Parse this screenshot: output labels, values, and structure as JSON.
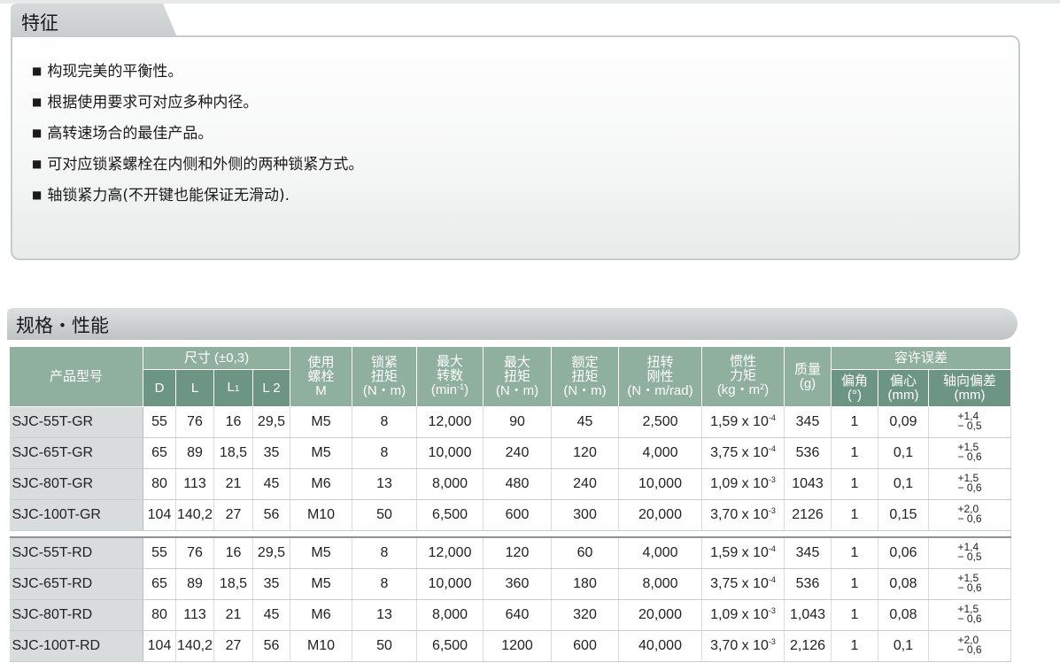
{
  "features": {
    "title": "特征",
    "items": [
      "构现完美的平衡性。",
      "根据使用要求可对应多种内径。",
      "高转速场合的最佳产品。",
      "可对应锁紧螺栓在内侧和外侧的两种锁紧方式。",
      "轴锁紧力高(不开键也能保证无滑动)."
    ]
  },
  "specs": {
    "title": "规格・性能",
    "headers": {
      "model": "产品型号",
      "dims": "尺寸 (±0,3)",
      "d": "D",
      "l": "L",
      "l1_base": "L",
      "l1_sub": "1",
      "l2": "L 2",
      "bolt_1": "使用",
      "bolt_2": "螺栓",
      "bolt_3": "M",
      "lock_1": "锁紧",
      "lock_2": "扭矩",
      "lock_3": "(N・m)",
      "speed_1": "最大",
      "speed_2": "转数",
      "speed_3": "(min",
      "speed_sup": "-1",
      "speed_4": ")",
      "maxt_1": "最大",
      "maxt_2": "扭矩",
      "maxt_3": "(N・m)",
      "rated_1": "额定",
      "rated_2": "扭矩",
      "rated_3": "(N・m)",
      "stiff_1": "扭转",
      "stiff_2": "刚性",
      "stiff_3": "(N・m/rad)",
      "inertia_1": "惯性",
      "inertia_2": "力矩",
      "inertia_3": "(kg・m",
      "inertia_sup": "2",
      "inertia_4": ")",
      "mass_1": "质量",
      "mass_2": "(g)",
      "tol": "容许误差",
      "ang_1": "偏角",
      "ang_2": "(°)",
      "ecc_1": "偏心",
      "ecc_2": "(mm)",
      "axial_1": "轴向偏差",
      "axial_2": "(mm)"
    },
    "group1": [
      {
        "model": "SJC-55T-GR",
        "d": "55",
        "l": "76",
        "l1": "16",
        "l2": "29,5",
        "bolt": "M5",
        "lock": "8",
        "speed": "12,000",
        "maxt": "90",
        "rated": "45",
        "stiff": "2,500",
        "inertia": "1,59 x 10",
        "inertia_exp": "-4",
        "mass": "345",
        "ang": "1",
        "ecc": "0,09",
        "tol_plus": "+1,4",
        "tol_minus": "− 0,5"
      },
      {
        "model": "SJC-65T-GR",
        "d": "65",
        "l": "89",
        "l1": "18,5",
        "l2": "35",
        "bolt": "M5",
        "lock": "8",
        "speed": "10,000",
        "maxt": "240",
        "rated": "120",
        "stiff": "4,000",
        "inertia": "3,75 x 10",
        "inertia_exp": "-4",
        "mass": "536",
        "ang": "1",
        "ecc": "0,1",
        "tol_plus": "+1,5",
        "tol_minus": "− 0,6"
      },
      {
        "model": "SJC-80T-GR",
        "d": "80",
        "l": "113",
        "l1": "21",
        "l2": "45",
        "bolt": "M6",
        "lock": "13",
        "speed": "8,000",
        "maxt": "480",
        "rated": "240",
        "stiff": "10,000",
        "inertia": "1,09 x 10",
        "inertia_exp": "-3",
        "mass": "1043",
        "ang": "1",
        "ecc": "0,1",
        "tol_plus": "+1,5",
        "tol_minus": "− 0,6"
      },
      {
        "model": "SJC-100T-GR",
        "d": "104",
        "l": "140,2",
        "l1": "27",
        "l2": "56",
        "bolt": "M10",
        "lock": "50",
        "speed": "6,500",
        "maxt": "600",
        "rated": "300",
        "stiff": "20,000",
        "inertia": "3,70 x 10",
        "inertia_exp": "-3",
        "mass": "2126",
        "ang": "1",
        "ecc": "0,15",
        "tol_plus": "+2,0",
        "tol_minus": "− 0,6"
      }
    ],
    "group2": [
      {
        "model": "SJC-55T-RD",
        "d": "55",
        "l": "76",
        "l1": "16",
        "l2": "29,5",
        "bolt": "M5",
        "lock": "8",
        "speed": "12,000",
        "maxt": "120",
        "rated": "60",
        "stiff": "4,000",
        "inertia": "1,59 x 10",
        "inertia_exp": "-4",
        "mass": "345",
        "ang": "1",
        "ecc": "0,06",
        "tol_plus": "+1,4",
        "tol_minus": "− 0,5"
      },
      {
        "model": "SJC-65T-RD",
        "d": "65",
        "l": "89",
        "l1": "18,5",
        "l2": "35",
        "bolt": "M5",
        "lock": "8",
        "speed": "10,000",
        "maxt": "360",
        "rated": "180",
        "stiff": "8,000",
        "inertia": "3,75 x 10",
        "inertia_exp": "-4",
        "mass": "536",
        "ang": "1",
        "ecc": "0,08",
        "tol_plus": "+1,5",
        "tol_minus": "− 0,6"
      },
      {
        "model": "SJC-80T-RD",
        "d": "80",
        "l": "113",
        "l1": "21",
        "l2": "45",
        "bolt": "M6",
        "lock": "13",
        "speed": "8,000",
        "maxt": "640",
        "rated": "320",
        "stiff": "20,000",
        "inertia": "1,09 x 10",
        "inertia_exp": "-3",
        "mass": "1,043",
        "ang": "1",
        "ecc": "0,08",
        "tol_plus": "+1,5",
        "tol_minus": "− 0,6"
      },
      {
        "model": "SJC-100T-RD",
        "d": "104",
        "l": "140,2",
        "l1": "27",
        "l2": "56",
        "bolt": "M10",
        "lock": "50",
        "speed": "6,500",
        "maxt": "1200",
        "rated": "600",
        "stiff": "40,000",
        "inertia": "3,70 x 10",
        "inertia_exp": "-3",
        "mass": "2,126",
        "ang": "1",
        "ecc": "0,1",
        "tol_plus": "+2,0",
        "tol_minus": "− 0,6"
      }
    ]
  }
}
